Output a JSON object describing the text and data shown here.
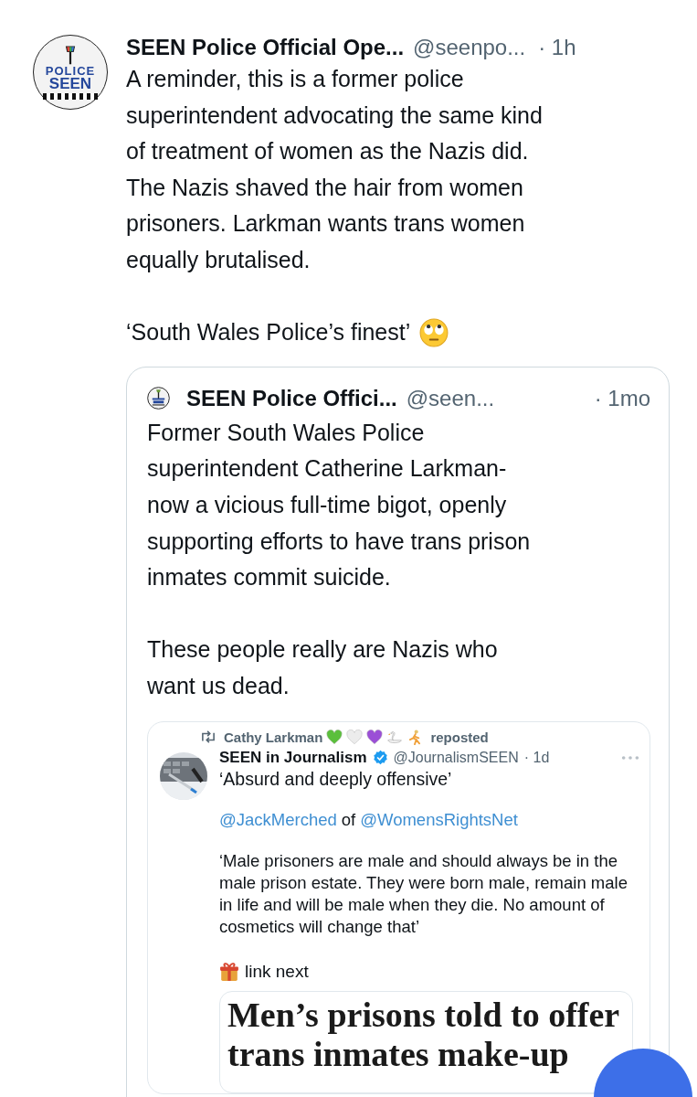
{
  "tweet": {
    "avatar": {
      "logo_lines": [
        "POLICE",
        "SEEN"
      ]
    },
    "author": "SEEN Police Official Ope...",
    "handle": "@seenpo...",
    "time": "· 1h",
    "paragraphs": [
      "A reminder, this is a former police\nsuperintendent advocating the same kind\nof treatment of women as the Nazis did.\nThe Nazis shaved the hair from women\nprisoners. Larkman wants trans women\nequally brutalised.",
      "‘South Wales Police’s finest’"
    ],
    "trailing_emoji": {
      "kind": "eye-roll"
    },
    "quote": {
      "author": "SEEN Police Offici...",
      "handle": "@seen...",
      "time": "· 1mo",
      "text": "Former South Wales Police\nsuperintendent Catherine Larkman-\nnow a vicious full-time bigot, openly\nsupporting efforts to have trans prison\ninmates commit suicide.\n\nThese people really are Nazis who\nwant us dead.",
      "screenshot": {
        "repost_by": "Cathy Larkman",
        "name_emojis": [
          {
            "kind": "heart",
            "color": "#5bbf3c"
          },
          {
            "kind": "heart",
            "color": "#ececec"
          },
          {
            "kind": "heart",
            "color": "#9b4fd6"
          },
          {
            "kind": "swan"
          },
          {
            "kind": "runner"
          }
        ],
        "repost_label": "reposted",
        "author": "SEEN in Journalism",
        "verified": true,
        "handle": "@JournalismSEEN",
        "time": "· 1d",
        "headline_text": "‘Absurd and deeply offensive’",
        "mentions": [
          {
            "kind": "mention",
            "text": "@JackMerched"
          },
          {
            "kind": "word",
            "text": "of"
          },
          {
            "kind": "mention",
            "text": "@WomensRightsNet"
          }
        ],
        "quote_text": "‘Male prisoners are male and should always be in the\nmale prison estate. They were born male, remain male\nin life and will be male when they die.  No amount of\ncosmetics will change that’",
        "link_note": "link next",
        "article_headline": "Men’s prisons told to offer\ntrans inmates make-up"
      }
    }
  }
}
